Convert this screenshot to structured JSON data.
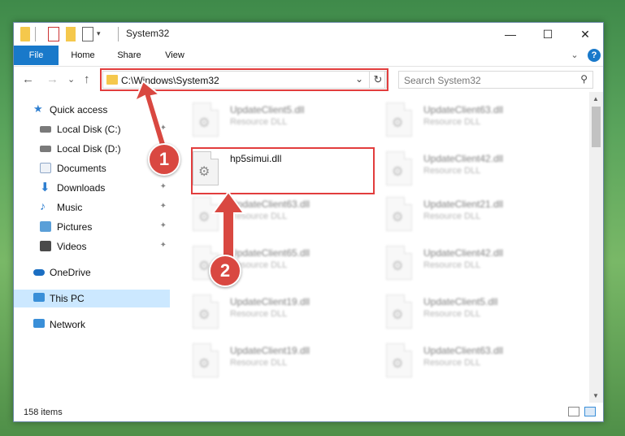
{
  "window": {
    "title": "System32",
    "controls": {
      "minimize": "—",
      "maximize": "☐",
      "close": "✕"
    }
  },
  "ribbon": {
    "tabs": [
      "File",
      "Home",
      "Share",
      "View"
    ],
    "expand_glyph": "⌄",
    "help_glyph": "?"
  },
  "nav": {
    "back_glyph": "←",
    "forward_glyph": "→",
    "recent_glyph": "⌄",
    "up_glyph": "↑",
    "address": "C:\\Windows\\System32",
    "address_dropdown_glyph": "⌄",
    "refresh_glyph": "↻",
    "search_placeholder": "Search System32",
    "search_glyph": "⚲"
  },
  "sidebar": {
    "items": [
      {
        "label": "Quick access",
        "icon": "star-icon",
        "color": "#2f7fd0"
      },
      {
        "label": "Local Disk (C:)",
        "icon": "drive-icon",
        "color": "#6b6b6b",
        "pinned": true
      },
      {
        "label": "Local Disk (D:)",
        "icon": "drive-icon",
        "color": "#6b6b6b",
        "pinned": true
      },
      {
        "label": "Documents",
        "icon": "documents-icon",
        "color": "#8fa8c8",
        "pinned": true
      },
      {
        "label": "Downloads",
        "icon": "downloads-icon",
        "color": "#2f7fd0",
        "pinned": true
      },
      {
        "label": "Music",
        "icon": "music-icon",
        "color": "#2f7fd0",
        "pinned": true
      },
      {
        "label": "Pictures",
        "icon": "pictures-icon",
        "color": "#5a9fd8",
        "pinned": true
      },
      {
        "label": "Videos",
        "icon": "videos-icon",
        "color": "#4a4a4a",
        "pinned": true
      },
      {
        "label": "OneDrive",
        "icon": "onedrive-icon",
        "color": "#1b6ec2"
      },
      {
        "label": "This PC",
        "icon": "pc-icon",
        "color": "#3a8fd8",
        "selected": true
      },
      {
        "label": "Network",
        "icon": "network-icon",
        "color": "#3a8fd8"
      }
    ],
    "pin_glyph": "📌"
  },
  "files": [
    {
      "name": "UpdateClient5.dll",
      "type": "Resource DLL"
    },
    {
      "name": "UpdateClient63.dll",
      "type": "Resource DLL"
    },
    {
      "name": "hp5simui.dll",
      "type": ""
    },
    {
      "name": "UpdateClient42.dll",
      "type": "Resource DLL"
    },
    {
      "name": "UpdateClient63.dll",
      "type": "Resource DLL"
    },
    {
      "name": "UpdateClient21.dll",
      "type": "Resource DLL"
    },
    {
      "name": "UpdateClient65.dll",
      "type": "Resource DLL"
    },
    {
      "name": "UpdateClient42.dll",
      "type": "Resource DLL"
    },
    {
      "name": "UpdateClient19.dll",
      "type": "Resource DLL"
    },
    {
      "name": "UpdateClient5.dll",
      "type": "Resource DLL"
    },
    {
      "name": "UpdateClient19.dll",
      "type": "Resource DLL"
    },
    {
      "name": "UpdateClient63.dll",
      "type": "Resource DLL"
    }
  ],
  "status": {
    "item_count": "158 items"
  },
  "annotations": {
    "step1": "1",
    "step2": "2",
    "highlight_color": "#e23d3d"
  }
}
